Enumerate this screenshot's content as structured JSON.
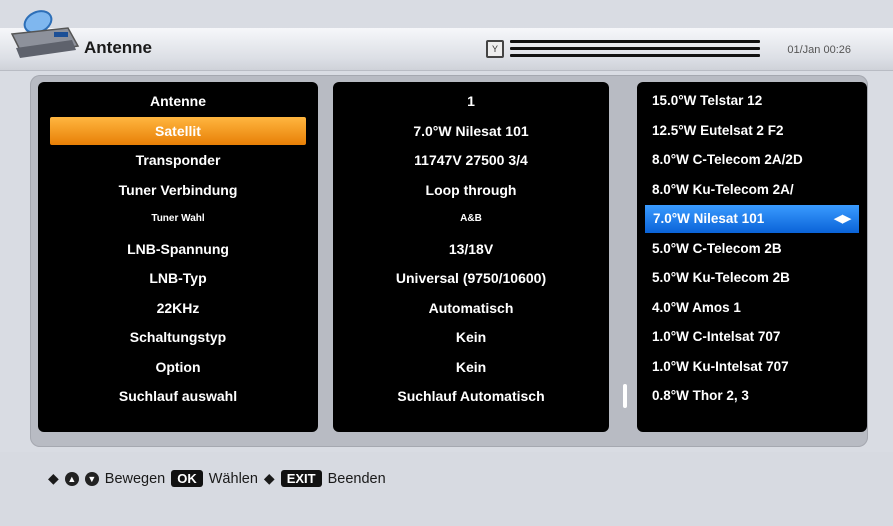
{
  "header": {
    "title": "Antenne",
    "clock": "01/Jan 00:26",
    "signal_icon": "antenna-signal-icon"
  },
  "labels": [
    "Antenne",
    "Satellit",
    "Transponder",
    "Tuner Verbindung",
    "Tuner Wahl",
    "LNB-Spannung",
    "LNB-Typ",
    "22KHz",
    "Schaltungstyp",
    "Option",
    "Suchlauf auswahl"
  ],
  "values": [
    "1",
    "7.0°W Nilesat 101",
    "11747V 27500 3/4",
    "Loop through",
    "A&B",
    "13/18V",
    "Universal (9750/10600)",
    "Automatisch",
    "Kein",
    "Kein",
    "Suchlauf Automatisch"
  ],
  "satellites": [
    "15.0°W Telstar 12",
    "12.5°W Eutelsat 2 F2",
    "8.0°W C-Telecom 2A/2D",
    "8.0°W Ku-Telecom 2A/",
    "7.0°W Nilesat 101",
    "5.0°W C-Telecom 2B",
    "5.0°W Ku-Telecom 2B",
    "4.0°W Amos 1",
    "1.0°W C-Intelsat 707",
    "1.0°W Ku-Intelsat 707",
    "0.8°W Thor 2, 3"
  ],
  "selected": {
    "label_index": 1,
    "satellite_index": 4
  },
  "footer": {
    "move": "Bewegen",
    "ok_key": "OK",
    "select": "Wählen",
    "exit_key": "EXIT",
    "exit": "Beenden"
  },
  "colors": {
    "highlight": "#f39a1c",
    "selection": "#1f7fee"
  }
}
